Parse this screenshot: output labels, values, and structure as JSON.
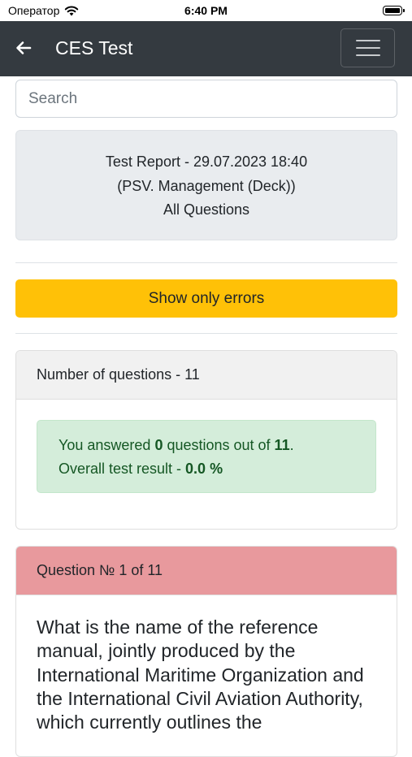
{
  "status_bar": {
    "carrier": "Оператор",
    "time": "6:40 PM"
  },
  "navbar": {
    "title": "CES Test",
    "back_icon": "arrow-left-icon",
    "menu_icon": "hamburger-menu-icon"
  },
  "search": {
    "placeholder": "Search",
    "value": ""
  },
  "report": {
    "line1": "Test Report - 29.07.2023 18:40",
    "line2": "(PSV. Management (Deck))",
    "line3": "All Questions"
  },
  "show_errors_button": {
    "label": "Show only errors",
    "color": "#ffc107"
  },
  "summary": {
    "header": "Number of questions - 11",
    "answered_prefix": "You answered ",
    "answered_count": "0",
    "answered_middle": " questions out of ",
    "total_count": "11",
    "answered_suffix": ".",
    "result_prefix": "Overall test result - ",
    "result_value": "0.0 %"
  },
  "question": {
    "header": "Question № 1 of 11",
    "text": "What is the name of the reference manual, jointly produced by the International Maritime Organization and the International Civil Aviation Authority, which currently outlines the",
    "header_color": "#e8999d"
  }
}
